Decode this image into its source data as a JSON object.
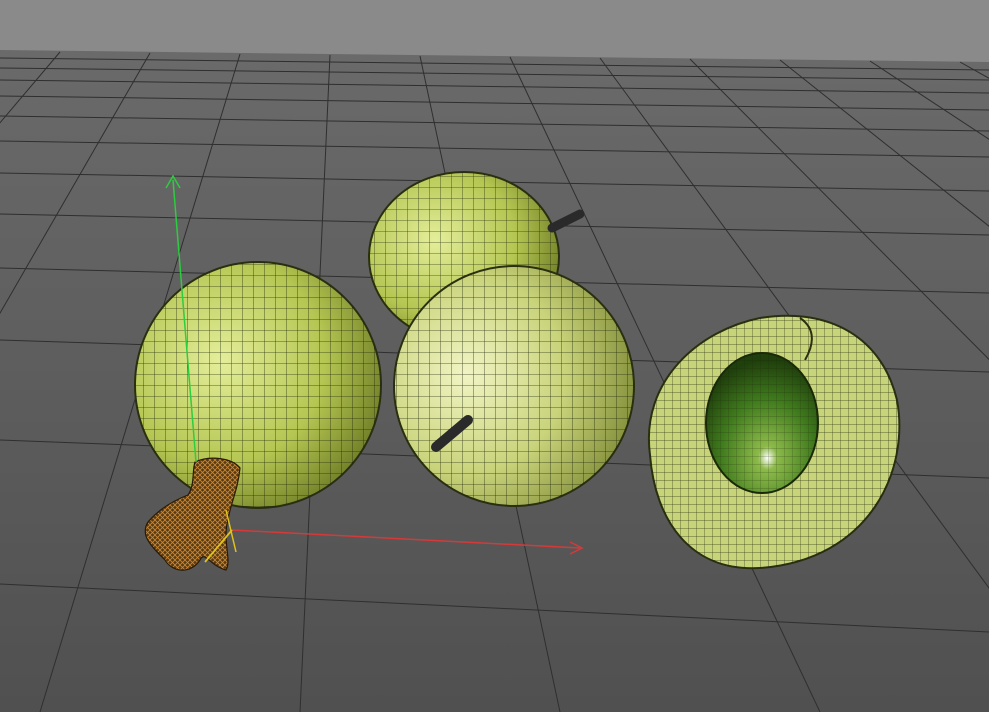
{
  "viewport": {
    "name": "3d-viewport",
    "background_sky": "#8a8a8a",
    "floor_color": "#585858",
    "grid_color": "#2f2f2f"
  },
  "objects": [
    {
      "name": "gooseberry-left",
      "kind": "whole fruit with dried calyx",
      "color": "#b8c95a"
    },
    {
      "name": "gooseberry-back",
      "kind": "whole fruit with stem",
      "color": "#c2d068"
    },
    {
      "name": "gooseberry-front",
      "kind": "whole fruit with stem",
      "color": "#c8d37a"
    },
    {
      "name": "gooseberry-half",
      "kind": "cut fruit with seed",
      "color": "#b8c66a"
    }
  ],
  "gizmo": {
    "x_axis_color": "#d43a3a",
    "y_axis_color": "#2ecc40",
    "z_axis_color": "#e0c21a"
  }
}
